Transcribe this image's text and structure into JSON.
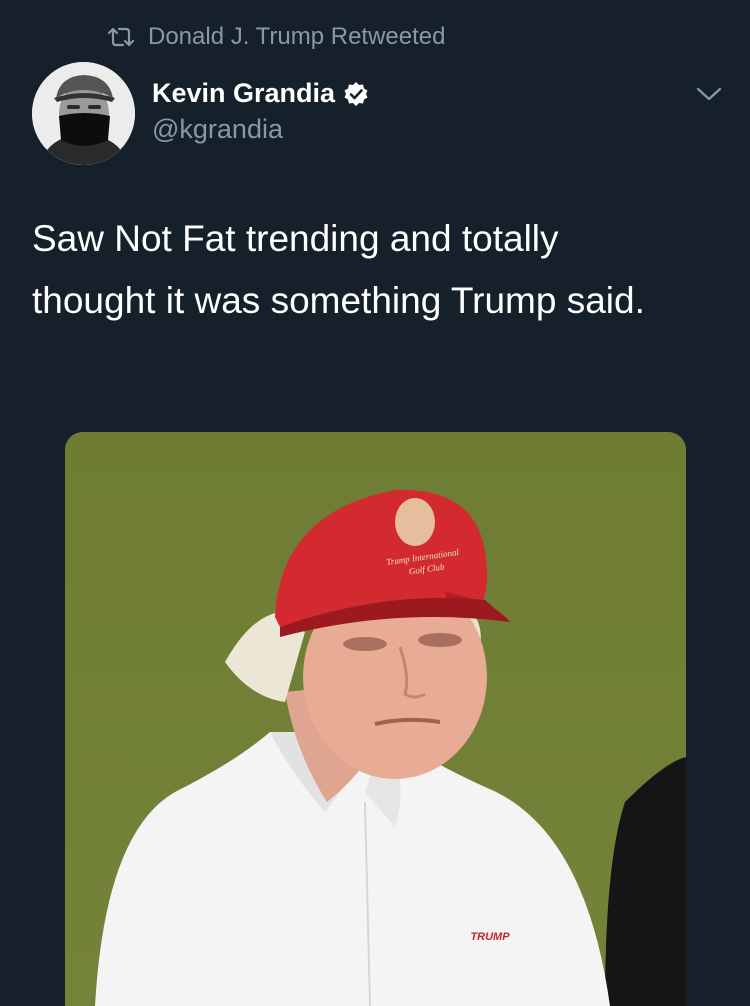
{
  "retweet": {
    "icon": "retweet-icon",
    "label": "Donald J. Trump Retweeted"
  },
  "tweet": {
    "author": {
      "display_name": "Kevin Grandia",
      "handle": "@kgrandia",
      "verified": true,
      "avatar": "avatar-image"
    },
    "menu_icon": "chevron-down-icon",
    "text": "Saw Not Fat trending and totally thought it was something Trump said.",
    "media": {
      "description_icon": "photo-image",
      "cap_text_line1": "Trump International",
      "cap_text_line2": "Golf Club",
      "shirt_text": "TRUMP"
    }
  },
  "colors": {
    "background": "#15202b",
    "secondary_text": "#8899a6",
    "primary_text": "#ffffff"
  }
}
